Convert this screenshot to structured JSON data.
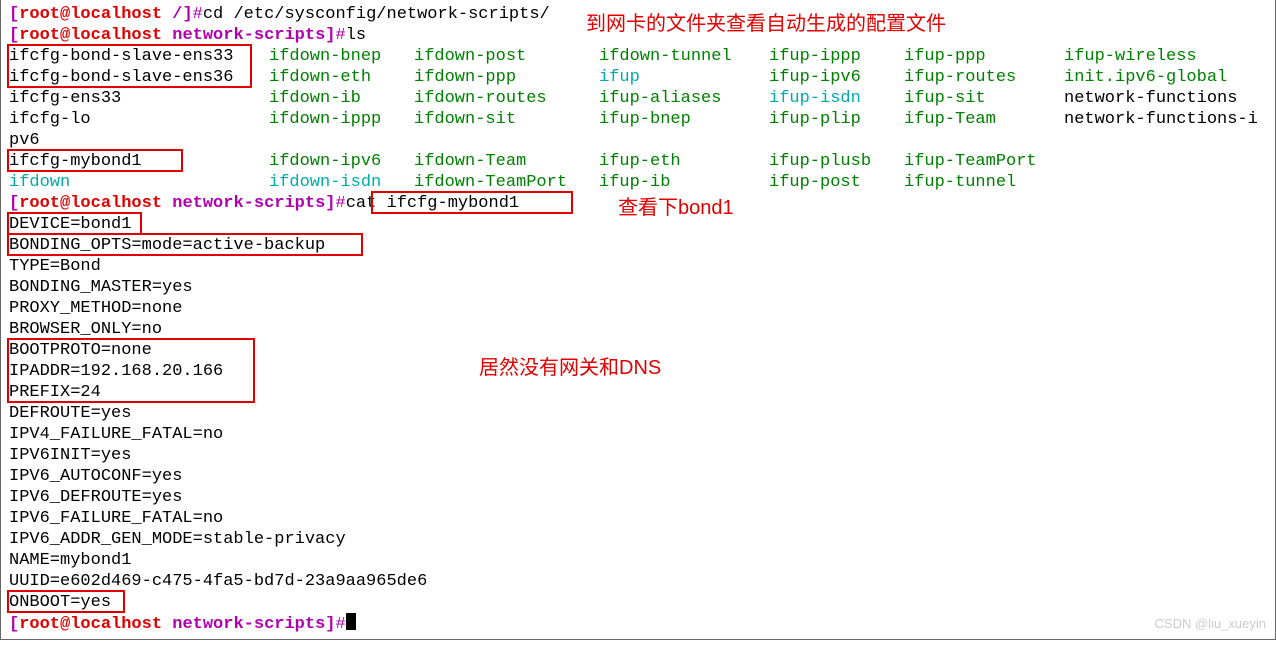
{
  "prompt": {
    "open": "[",
    "user": "root",
    "at": "@",
    "host": "localhost",
    "dir_root": " /",
    "dir_ns": " network-scripts",
    "close": "]",
    "hash": "#"
  },
  "cmd": {
    "cd": "cd /etc/sysconfig/network-scripts/",
    "ls": "ls",
    "cat": "cat ifcfg-mybond1"
  },
  "ls": {
    "c1": {
      "r1": "ifcfg-bond-slave-ens33",
      "r2": "ifcfg-bond-slave-ens36",
      "r3": "ifcfg-ens33",
      "r4": "ifcfg-lo",
      "r5": "pv6",
      "r6": "ifcfg-mybond1",
      "r7": "ifdown"
    },
    "c2": {
      "r1": "ifdown-bnep",
      "r2": "ifdown-eth",
      "r3": "ifdown-ib",
      "r4": "ifdown-ippp",
      "r5": "",
      "r6": "ifdown-ipv6",
      "r7": "ifdown-isdn"
    },
    "c3": {
      "r1": "ifdown-post",
      "r2": "ifdown-ppp",
      "r3": "ifdown-routes",
      "r4": "ifdown-sit",
      "r5": "",
      "r6": "ifdown-Team",
      "r7": "ifdown-TeamPort"
    },
    "c4": {
      "r1": "ifdown-tunnel",
      "r2": "ifup",
      "r3": "ifup-aliases",
      "r4": "ifup-bnep",
      "r5": "",
      "r6": "ifup-eth",
      "r7": "ifup-ib"
    },
    "c5": {
      "r1": "ifup-ippp",
      "r2": "ifup-ipv6",
      "r3": "ifup-isdn",
      "r4": "ifup-plip",
      "r5": "",
      "r6": "ifup-plusb",
      "r7": "ifup-post"
    },
    "c6": {
      "r1": "ifup-ppp",
      "r2": "ifup-routes",
      "r3": "ifup-sit",
      "r4": "ifup-Team",
      "r5": "",
      "r6": "ifup-TeamPort",
      "r7": "ifup-tunnel"
    },
    "c7": {
      "r1": "ifup-wireless",
      "r2": "init.ipv6-global",
      "r3": "network-functions",
      "r4": "network-functions-i",
      "r5": "",
      "r6": "",
      "r7": ""
    }
  },
  "cfg": {
    "l1": "DEVICE=bond1",
    "l2": "BONDING_OPTS=mode=active-backup",
    "l3": "TYPE=Bond",
    "l4": "BONDING_MASTER=yes",
    "l5": "PROXY_METHOD=none",
    "l6": "BROWSER_ONLY=no",
    "l7": "BOOTPROTO=none",
    "l8": "IPADDR=192.168.20.166",
    "l9": "PREFIX=24",
    "l10": "DEFROUTE=yes",
    "l11": "IPV4_FAILURE_FATAL=no",
    "l12": "IPV6INIT=yes",
    "l13": "IPV6_AUTOCONF=yes",
    "l14": "IPV6_DEFROUTE=yes",
    "l15": "IPV6_FAILURE_FATAL=no",
    "l16": "IPV6_ADDR_GEN_MODE=stable-privacy",
    "l17": "NAME=mybond1",
    "l18": "UUID=e602d469-c475-4fa5-bd7d-23a9aa965de6",
    "l19": "ONBOOT=yes"
  },
  "anno": {
    "a1": "到网卡的文件夹查看自动生成的配置文件",
    "a2": "查看下bond1",
    "a3": "居然没有网关和DNS"
  },
  "watermark": "CSDN @liu_xueyin"
}
